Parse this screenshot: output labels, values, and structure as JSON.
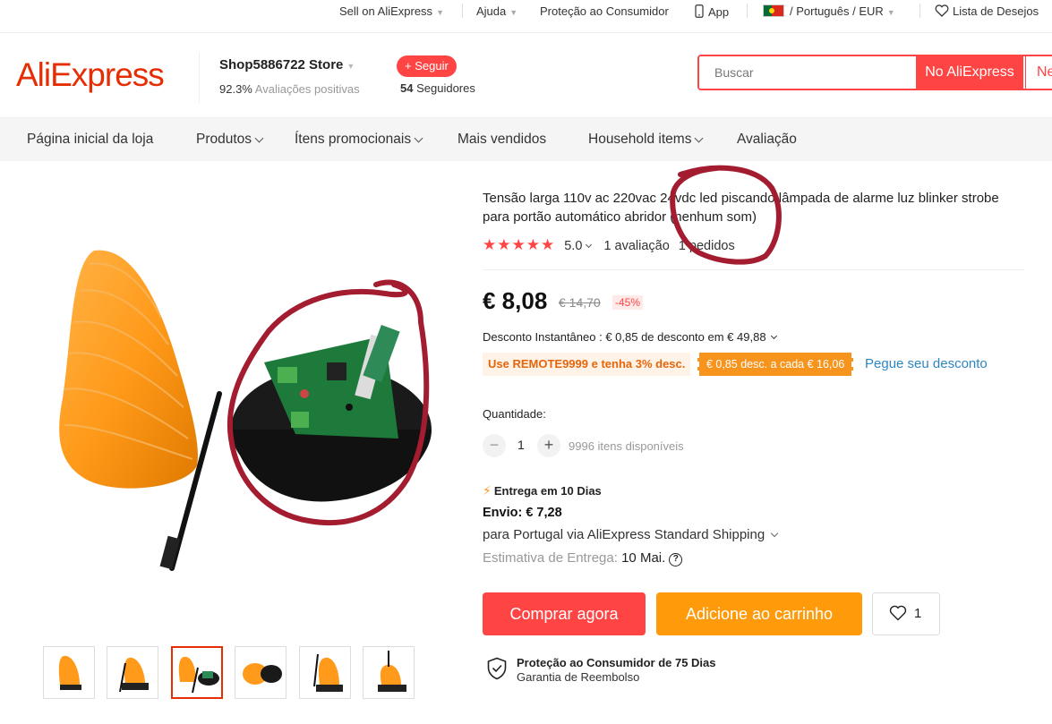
{
  "topbar": {
    "sell": "Sell on AliExpress",
    "help": "Ajuda",
    "protection": "Proteção ao Consumidor",
    "app": "App",
    "language": "/ Português /",
    "currency": "EUR",
    "wishlist": "Lista de Desejos"
  },
  "header": {
    "logo": "AliExpress",
    "store_name": "Shop5886722 Store",
    "rating_value": "92.3%",
    "rating_label": "Avaliações positivas",
    "follow_label": "+ Seguir",
    "followers_count": "54",
    "followers_label": "Seguidores",
    "search_placeholder": "Buscar",
    "search_button": "No AliExpress",
    "search_button2": "Ne"
  },
  "nav": {
    "items": [
      {
        "label": "Página inicial da loja"
      },
      {
        "label": "Produtos"
      },
      {
        "label": "Ítens promocionais"
      },
      {
        "label": "Mais vendidos"
      },
      {
        "label": "Household items"
      },
      {
        "label": "Avaliação"
      }
    ]
  },
  "product": {
    "title": "Tensão larga 110v ac 220vac 24vdc led piscando lâmpada de alarme luz blinker strobe para portão automático abridor (nenhum som)",
    "stars": "★★★★★",
    "rating": "5.0",
    "reviews": "1 avaliação",
    "orders": "1 pedidos",
    "price": "€ 8,08",
    "old_price": "€ 14,70",
    "discount": "-45%",
    "instant_discount": "Desconto Instantâneo : € 0,85 de desconto em € 49,88",
    "coupon_code": "Use REMOTE9999 e tenha 3% desc.",
    "coupon_store": "€ 0,85 desc. a cada € 16,06",
    "coupon_link": "Pegue seu desconto",
    "quantity_label": "Quantidade:",
    "quantity": "1",
    "qty_minus": "−",
    "qty_plus": "+",
    "available": "9996 itens disponíveis",
    "delivery_badge": "Entrega em 10 Dias",
    "shipping": "Envio: € 7,28",
    "shipping_via": "para Portugal via AliExpress Standard Shipping",
    "estimate_label": "Estimativa de Entrega:",
    "estimate_value": "10 Mai.",
    "buy_now": "Comprar agora",
    "add_to_cart": "Adicione ao carrinho",
    "wish_count": "1",
    "protection_title": "Proteção ao Consumidor de 75 Dias",
    "protection_sub": "Garantia de Reembolso"
  },
  "colors": {
    "accent": "#ff4747",
    "brand": "#e62e04",
    "orange": "#ff9a0a",
    "annotation": "#a31c2f"
  }
}
